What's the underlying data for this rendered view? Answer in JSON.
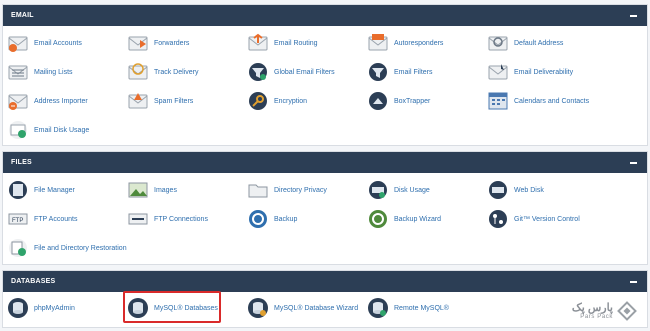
{
  "sections": {
    "email": {
      "title": "EMAIL",
      "items": [
        {
          "label": "Email Accounts",
          "icon": "email-accounts-icon"
        },
        {
          "label": "Forwarders",
          "icon": "forwarders-icon"
        },
        {
          "label": "Email Routing",
          "icon": "email-routing-icon"
        },
        {
          "label": "Autoresponders",
          "icon": "autoresponders-icon"
        },
        {
          "label": "Default Address",
          "icon": "default-address-icon"
        },
        {
          "label": "Mailing Lists",
          "icon": "mailing-lists-icon"
        },
        {
          "label": "Track Delivery",
          "icon": "track-delivery-icon"
        },
        {
          "label": "Global Email Filters",
          "icon": "global-email-filters-icon"
        },
        {
          "label": "Email Filters",
          "icon": "email-filters-icon"
        },
        {
          "label": "Email Deliverability",
          "icon": "email-deliverability-icon"
        },
        {
          "label": "Address Importer",
          "icon": "address-importer-icon"
        },
        {
          "label": "Spam Filters",
          "icon": "spam-filters-icon"
        },
        {
          "label": "Encryption",
          "icon": "encryption-icon"
        },
        {
          "label": "BoxTrapper",
          "icon": "boxtrapper-icon"
        },
        {
          "label": "Calendars and Contacts",
          "icon": "calendars-contacts-icon"
        },
        {
          "label": "Email Disk Usage",
          "icon": "email-disk-usage-icon"
        }
      ]
    },
    "files": {
      "title": "FILES",
      "items": [
        {
          "label": "File Manager",
          "icon": "file-manager-icon"
        },
        {
          "label": "Images",
          "icon": "images-icon"
        },
        {
          "label": "Directory Privacy",
          "icon": "directory-privacy-icon"
        },
        {
          "label": "Disk Usage",
          "icon": "disk-usage-icon"
        },
        {
          "label": "Web Disk",
          "icon": "web-disk-icon"
        },
        {
          "label": "FTP Accounts",
          "icon": "ftp-accounts-icon"
        },
        {
          "label": "FTP Connections",
          "icon": "ftp-connections-icon"
        },
        {
          "label": "Backup",
          "icon": "backup-icon"
        },
        {
          "label": "Backup Wizard",
          "icon": "backup-wizard-icon"
        },
        {
          "label": "Git™ Version Control",
          "icon": "git-icon"
        },
        {
          "label": "File and Directory Restoration",
          "icon": "file-restoration-icon"
        }
      ]
    },
    "databases": {
      "title": "DATABASES",
      "items": [
        {
          "label": "phpMyAdmin",
          "icon": "phpmyadmin-icon"
        },
        {
          "label": "MySQL® Databases",
          "icon": "mysql-databases-icon"
        },
        {
          "label": "MySQL® Database Wizard",
          "icon": "mysql-wizard-icon"
        },
        {
          "label": "Remote MySQL®",
          "icon": "remote-mysql-icon"
        }
      ]
    }
  },
  "highlighted_item": "MySQL® Databases",
  "brand": {
    "name": "پارس پک",
    "sub": "Pars Pack"
  },
  "colors": {
    "header": "#2c3e55",
    "link": "#2f6fae",
    "highlight": "#d92a2a"
  }
}
